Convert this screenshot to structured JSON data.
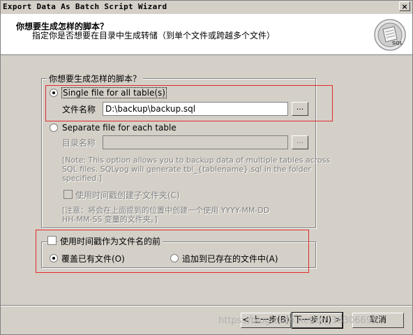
{
  "window": {
    "title": "Export Data As Batch Script Wizard",
    "close_label": "×"
  },
  "header": {
    "title": "你想要生成怎样的脚本？",
    "subtitle": "指定你是否想要在目录中生成转储（到单个文件或跨越多个文件）",
    "logo_text": "SQL"
  },
  "script_group": {
    "legend": "你想要生成怎样的脚本？",
    "single_file": {
      "label": "Single file for all table(s)",
      "checked": true
    },
    "file_name_label": "文件名称",
    "file_name_value": "D:\\backup\\backup.sql",
    "browse_label": "...",
    "separate_file": {
      "label": "Separate file for each table",
      "checked": false
    },
    "dir_name_label": "目录名称",
    "dir_name_value": "",
    "dir_browse_label": "...",
    "note_line1": "[Note: This option allows you to backup data of multiple tables across",
    "note_line2": "SQL files. SQLyog will generate tbl_{tablename}.sql in the folder",
    "note_line3": "specified.]",
    "timestamp_subfolder_label": "使用时间戳创建子文件夹(C)",
    "note2_line1": "[注意：将会在上面提到的位置中创建一个使用 YYYY-MM-DD",
    "note2_line2": "HH-MM-SS 变量的文件夹。]"
  },
  "prefix_group": {
    "legend": "使用时间戳作为文件名的前",
    "overwrite_label": "覆盖已有文件(O)",
    "overwrite_checked": true,
    "append_label": "追加到已存在的文件中(A)",
    "append_checked": false
  },
  "buttons": {
    "back": "< 上一步(B)",
    "next": "下一步(N) >",
    "cancel": "取消"
  },
  "watermark": "https://blog.csdn.net/qq_38306695"
}
